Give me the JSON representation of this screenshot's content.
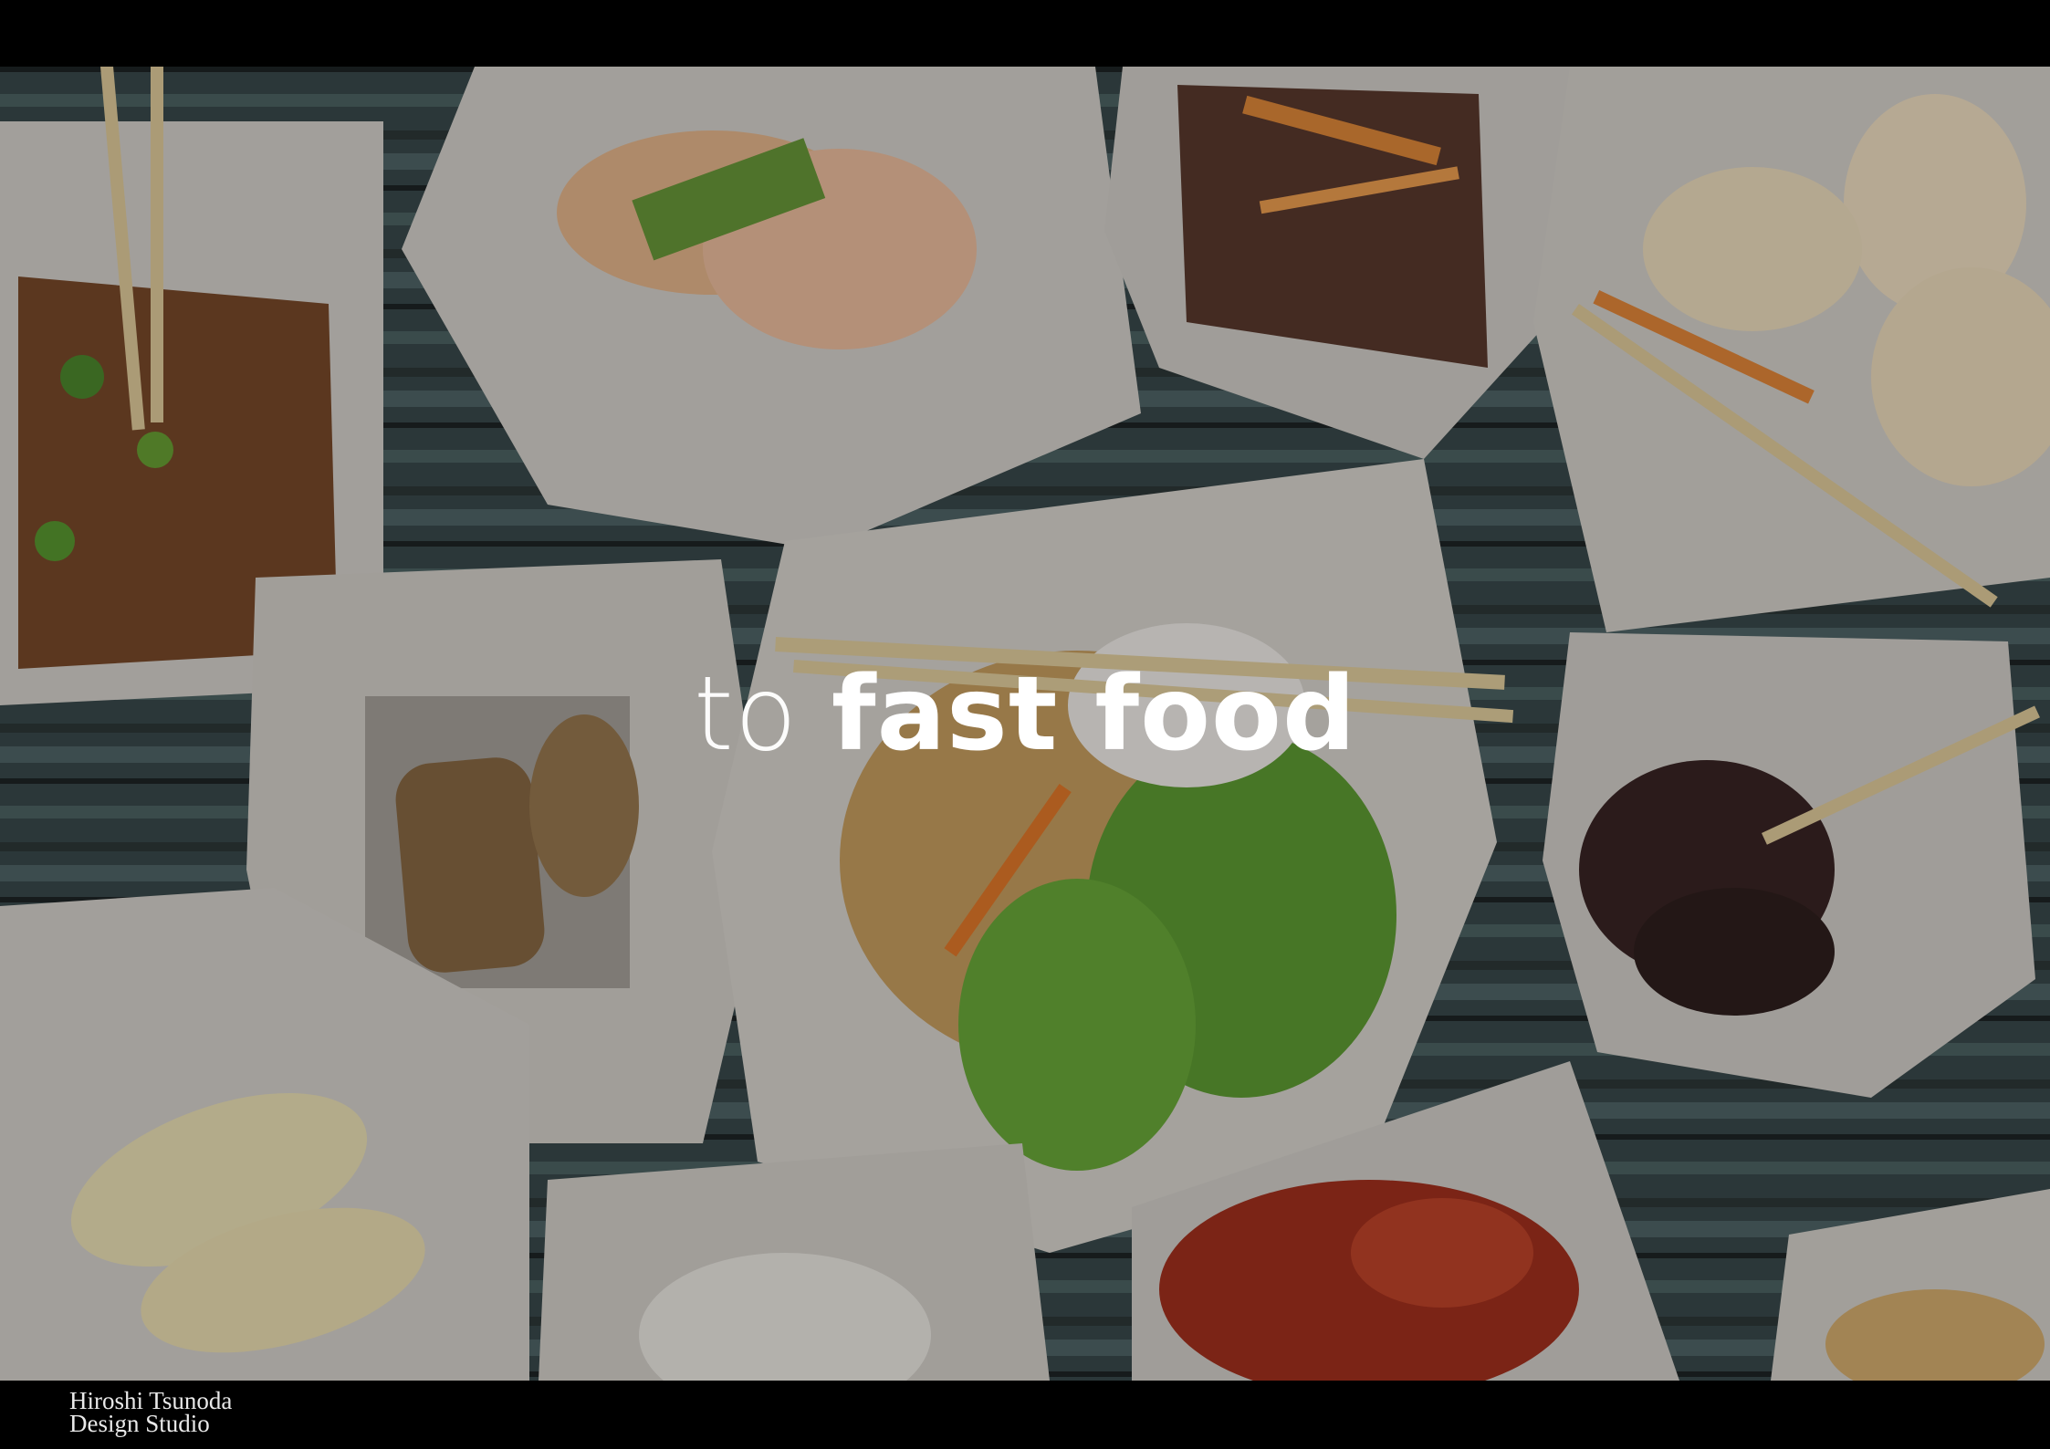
{
  "headline": {
    "prefix": "to",
    "emphasis": "fast food"
  },
  "footer": {
    "line1": "Hiroshi Tsunoda",
    "line2": "Design Studio"
  },
  "colors": {
    "background": "#000000",
    "text": "#ffffff",
    "overlay": "#000000"
  }
}
